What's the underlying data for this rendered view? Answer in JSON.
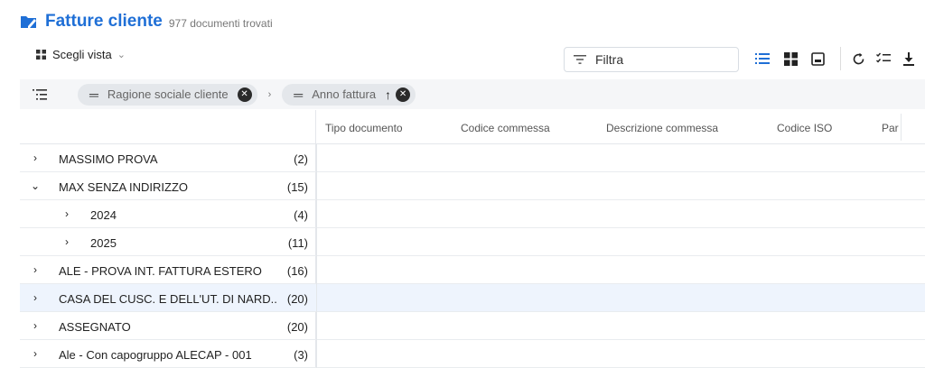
{
  "header": {
    "title": "Fatture cliente",
    "subtitle": "977 documenti trovati"
  },
  "toolbar": {
    "view_label": "Scegli vista",
    "filter_placeholder": "Filtra",
    "accent_color": "#1f6fd6"
  },
  "grouping": {
    "chips": [
      {
        "label": "Ragione sociale cliente"
      },
      {
        "label": "Anno fattura",
        "sort": "asc"
      }
    ]
  },
  "columns": [
    "Tipo documento",
    "Codice commessa",
    "Descrizione commessa",
    "Codice ISO",
    "Par"
  ],
  "rows": [
    {
      "label": "MASSIMO PROVA",
      "count": "(2)",
      "level": 0,
      "expanded": false
    },
    {
      "label": "MAX SENZA INDIRIZZO",
      "count": "(15)",
      "level": 0,
      "expanded": true
    },
    {
      "label": "2024",
      "count": "(4)",
      "level": 1,
      "expanded": false
    },
    {
      "label": "2025",
      "count": "(11)",
      "level": 1,
      "expanded": false
    },
    {
      "label": "ALE - PROVA INT. FATTURA ESTERO",
      "count": "(16)",
      "level": 0,
      "expanded": false
    },
    {
      "label": "CASA DEL CUSC. E DELL'UT. DI NARD...",
      "count": "(20)",
      "level": 0,
      "expanded": false,
      "highlight": true
    },
    {
      "label": "ASSEGNATO",
      "count": "(20)",
      "level": 0,
      "expanded": false
    },
    {
      "label": "Ale - Con capogruppo ALECAP - 001",
      "count": "(3)",
      "level": 0,
      "expanded": false
    }
  ]
}
